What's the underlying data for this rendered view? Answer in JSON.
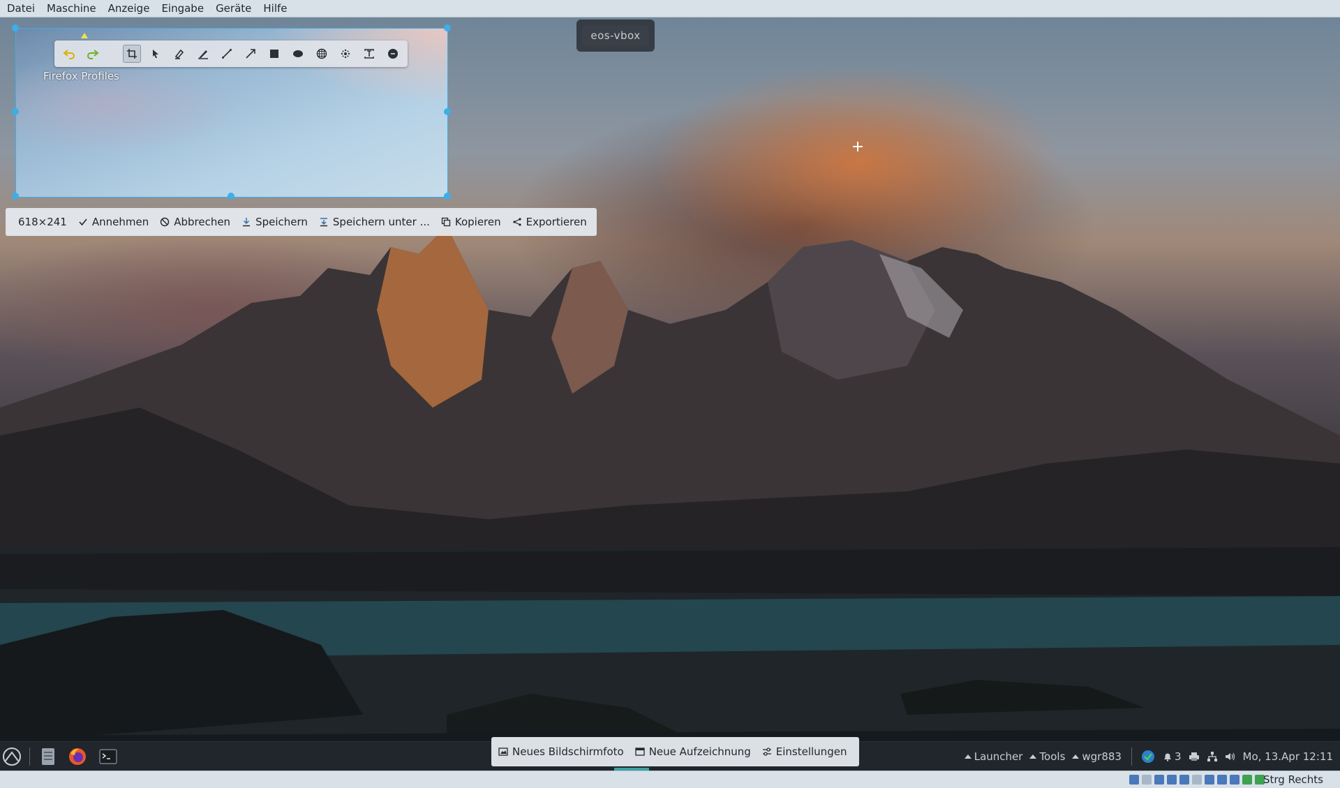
{
  "vm_menubar": {
    "items": [
      "Datei",
      "Maschine",
      "Anzeige",
      "Eingabe",
      "Geräte",
      "Hilfe"
    ]
  },
  "host_label": "eos-vbox",
  "selection": {
    "window_label": "Firefox Profiles",
    "size_text": "618×241"
  },
  "annotation_toolbar": {
    "tools": [
      "undo-icon",
      "redo-icon",
      "crop-icon",
      "select-icon",
      "highlighter-icon",
      "pen-icon",
      "line-icon",
      "arrow-icon",
      "rectangle-icon",
      "ellipse-icon",
      "pixelate-icon",
      "blur-icon",
      "text-icon",
      "number-stamp-icon"
    ],
    "active_tool": "crop-icon"
  },
  "action_bar": {
    "accept": "Annehmen",
    "cancel": "Abbrechen",
    "save": "Speichern",
    "save_as": "Speichern unter ...",
    "copy": "Kopieren",
    "export": "Exportieren"
  },
  "capture_bar": {
    "new_screenshot": "Neues Bildschirmfoto",
    "new_recording": "Neue Aufzeichnung",
    "settings": "Einstellungen"
  },
  "panel": {
    "launcher": "Launcher",
    "tools": "Tools",
    "user": "wgr883",
    "notification_count": "3",
    "clock": "Mo, 13.Apr 12:11"
  },
  "vm_status": {
    "host_key": "Strg Rechts"
  },
  "colors": {
    "accent": "#3daee9",
    "menubar_bg": "#d9e1e8",
    "panel_bg": "#22282e"
  }
}
